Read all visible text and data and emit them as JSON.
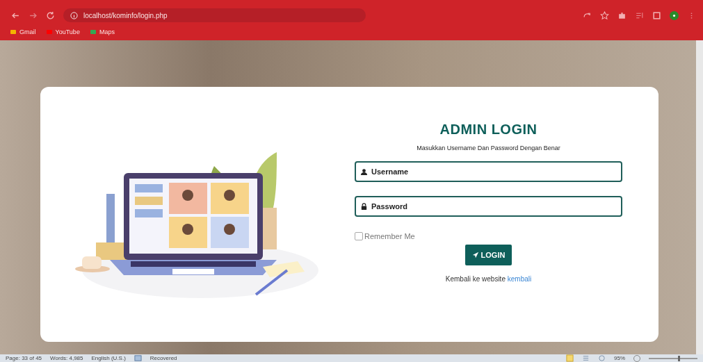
{
  "browser": {
    "url": "localhost/kominfo/login.php",
    "bookmarks": [
      {
        "label": "Gmail"
      },
      {
        "label": "YouTube"
      },
      {
        "label": "Maps"
      }
    ]
  },
  "login": {
    "title": "ADMIN LOGIN",
    "subtitle": "Masukkan Username Dan Password Dengan Benar",
    "fields": [
      {
        "kind": "user",
        "placeholder": "Username"
      },
      {
        "kind": "password",
        "placeholder": "Password"
      }
    ],
    "remember": {
      "label": "Remember Me",
      "checked": false
    },
    "button": "LOGIN",
    "back_text": "Kembali ke website",
    "back_link": "kembali"
  },
  "status_bar": {
    "page": "Page: 33 of 45",
    "words": "Words: 4,985",
    "language": "English (U.S.)",
    "state": "Recovered",
    "zoom": "95%",
    "zoom_level": {
      "level": 0.6
    }
  }
}
